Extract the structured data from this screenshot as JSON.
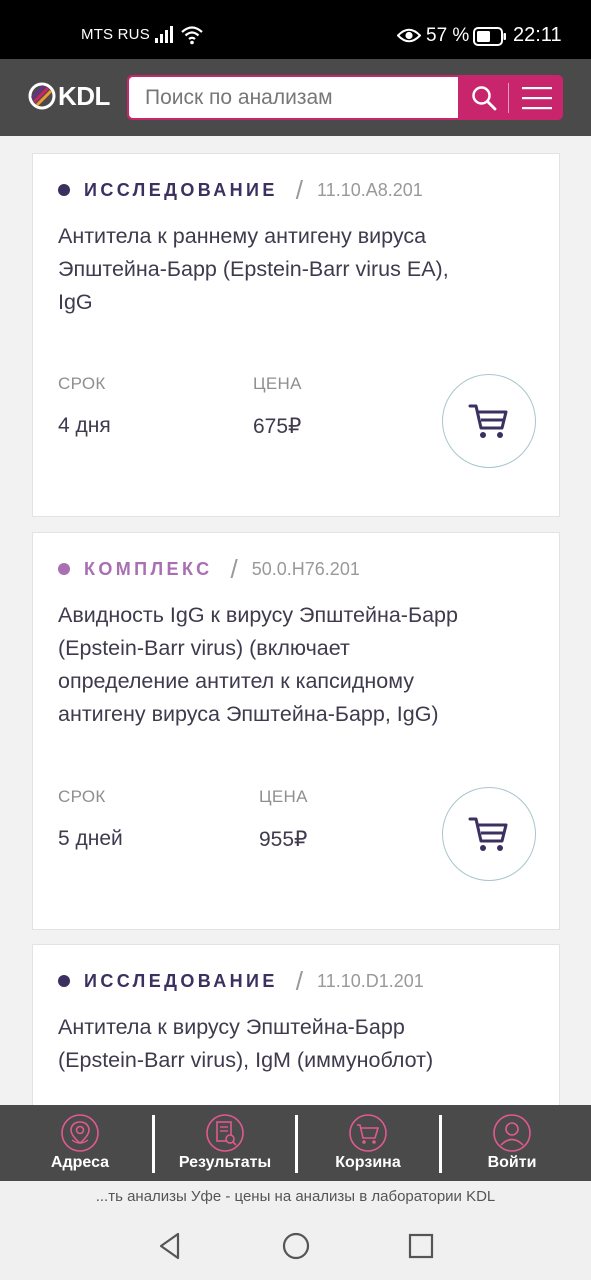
{
  "status_bar": {
    "carrier": "MTS RUS",
    "battery_percent": "57 %",
    "time": "22:11",
    "icons": [
      "signal-icon",
      "wifi-icon",
      "eye-icon",
      "battery-icon"
    ]
  },
  "header": {
    "logo_text": "KDL",
    "search_placeholder": "Поиск по анализам",
    "brand_color": "#c8256c",
    "header_bg": "#4a4a4a"
  },
  "cards": [
    {
      "type_label": "ИССЛЕДОВАНИЕ",
      "type_color": "#3b3060",
      "code": "11.10.A8.201",
      "title_lines": [
        "Антитела к раннему антигену вируса",
        "Эпштейна-Барр (Epstein-Barr virus EA),",
        "IgG"
      ],
      "term_label": "СРОК",
      "term_value": "4 дня",
      "price_label": "ЦЕНА",
      "price_value": "675₽"
    },
    {
      "type_label": "КОМПЛЕКС",
      "type_color": "#a86fb3",
      "code": "50.0.H76.201",
      "title_lines": [
        "Авидность IgG к вирусу Эпштейна-Барр",
        "(Epstein-Barr virus) (включает",
        "определение антител к капсидному",
        "антигену вируса Эпштейна-Барр, IgG)"
      ],
      "term_label": "СРОК",
      "term_value": "5 дней",
      "price_label": "ЦЕНА",
      "price_value": "955₽"
    },
    {
      "type_label": "ИССЛЕДОВАНИЕ",
      "type_color": "#3b3060",
      "code": "11.10.D1.201",
      "title_lines": [
        "Антитела к вирусу Эпштейна-Барр",
        "(Epstein-Barr virus), IgM (иммуноблот)"
      ]
    }
  ],
  "bottom_nav": [
    {
      "label": "Адреса",
      "icon": "location-pin-icon"
    },
    {
      "label": "Результаты",
      "icon": "document-search-icon"
    },
    {
      "label": "Корзина",
      "icon": "cart-icon"
    },
    {
      "label": "Войти",
      "icon": "user-icon"
    }
  ],
  "page_title": "...ть анализы Уфе - цены на анализы в лаборатории KDL",
  "system_nav": [
    "back-icon",
    "home-icon",
    "recents-icon"
  ]
}
